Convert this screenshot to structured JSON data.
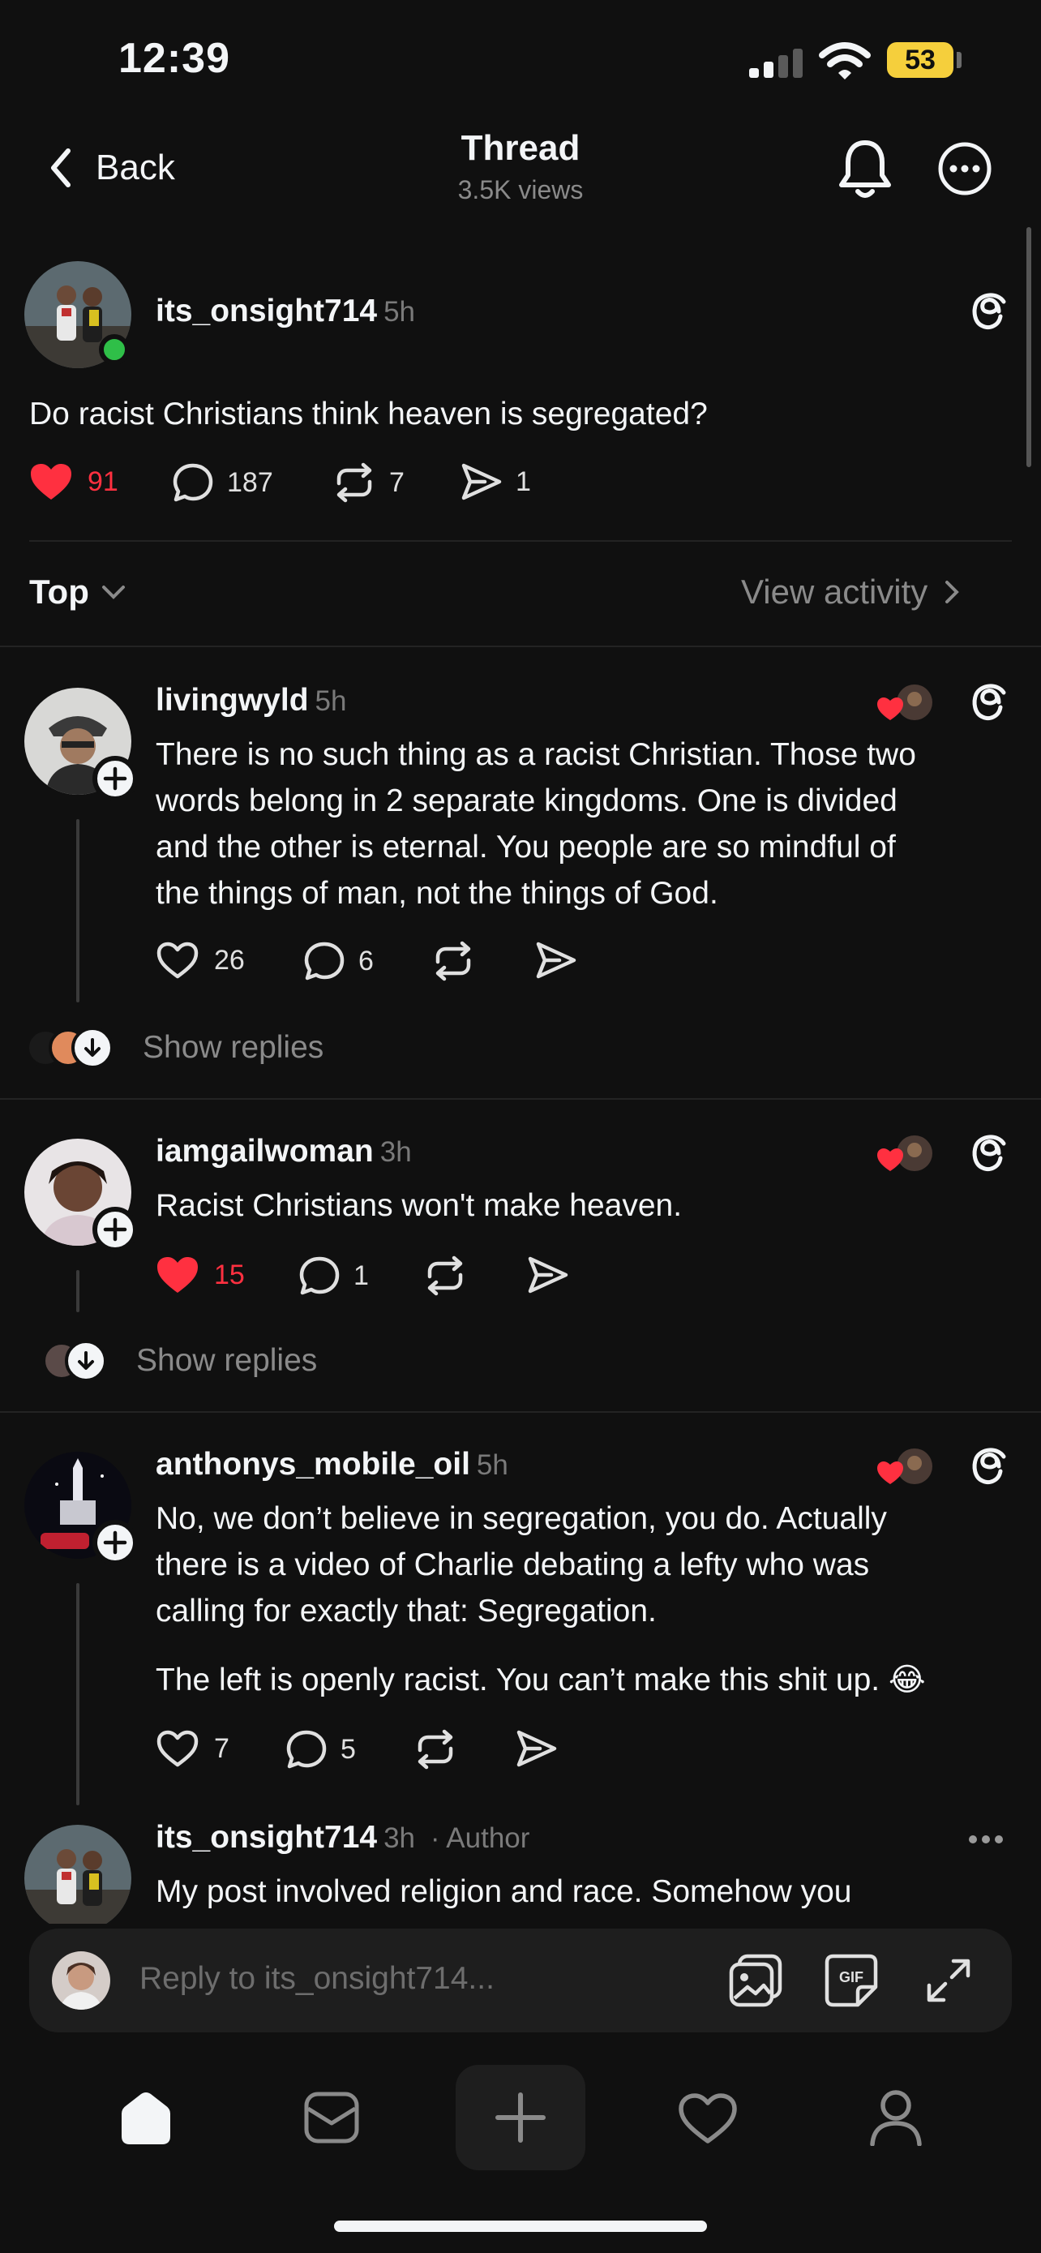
{
  "status_bar": {
    "time": "12:39",
    "battery": "53"
  },
  "nav": {
    "back_label": "Back",
    "title": "Thread",
    "subtitle": "3.5K views"
  },
  "post": {
    "username": "its_onsight714",
    "time": "5h",
    "text": "Do racist Christians think heaven is segregated?",
    "likes": "91",
    "replies": "187",
    "reposts": "7",
    "shares": "1"
  },
  "sort": {
    "label": "Top",
    "view_activity": "View activity"
  },
  "replies": [
    {
      "username": "livingwyld",
      "time": "5h",
      "lines": [
        "There is no such thing as a racist Christian. Those two",
        "words belong in 2 separate kingdoms. One is divided",
        "and the other is eternal. You people are so mindful of",
        "the things of man, not the things of God."
      ],
      "likes": "26",
      "replies": "6",
      "show_replies": "Show replies"
    },
    {
      "username": "iamgailwoman",
      "time": "3h",
      "lines": [
        "Racist Christians won't make heaven."
      ],
      "likes": "15",
      "replies": "1",
      "show_replies": "Show replies"
    },
    {
      "username": "anthonys_mobile_oil",
      "time": "5h",
      "lines": [
        "No, we don’t believe in segregation, you do. Actually",
        "there is a video of Charlie debating a lefty who was",
        "calling for exactly that: Segregation."
      ],
      "paragraph2": "The left is openly racist. You can’t make this shit up. 😂",
      "likes": "7",
      "replies": "5"
    },
    {
      "username": "its_onsight714",
      "time": "3h",
      "author_tag": "· Author",
      "lines": [
        "My post involved religion and race. Somehow you"
      ]
    }
  ],
  "composer": {
    "placeholder": "Reply to its_onsight714..."
  },
  "colors": {
    "background": "#101010",
    "like_red": "#ff3040",
    "battery_yellow": "#f5cf3c"
  }
}
